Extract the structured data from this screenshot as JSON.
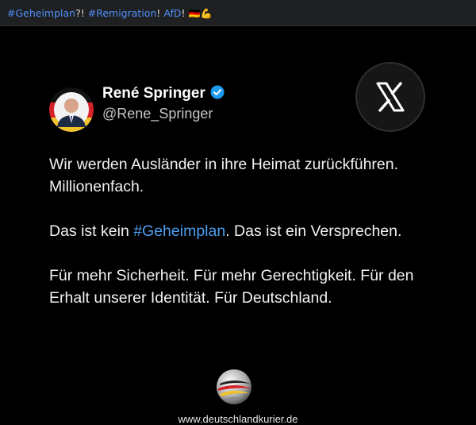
{
  "post": {
    "tag1": "#Geheimplan",
    "punct1": "?!",
    "tag2": "#Remigration",
    "punct2": "!",
    "tag3": "AfD",
    "punct3": "!",
    "emoji": "🇩🇪💪"
  },
  "tweet": {
    "author_name": "René Springer",
    "handle": "@Rene_Springer",
    "para1": "Wir werden Ausländer in ihre Heimat zurückführen. Millionenfach.",
    "para2_before": "Das ist kein ",
    "para2_tag": "#Geheimplan",
    "para2_after": ". Das ist ein Versprechen.",
    "para3": "Für mehr Sicherheit. Für mehr Gerechtigkeit. Für den Erhalt unserer Identität. Für Deutschland."
  },
  "footer": {
    "website": "www.deutschlandkurier.de"
  },
  "colors": {
    "hashtag": "#4f8ff7",
    "verified": "#1d9bf0",
    "background": "#000000"
  },
  "icons": [
    "x-logo-icon",
    "verified-badge-icon",
    "deutschlandkurier-logo-icon"
  ]
}
